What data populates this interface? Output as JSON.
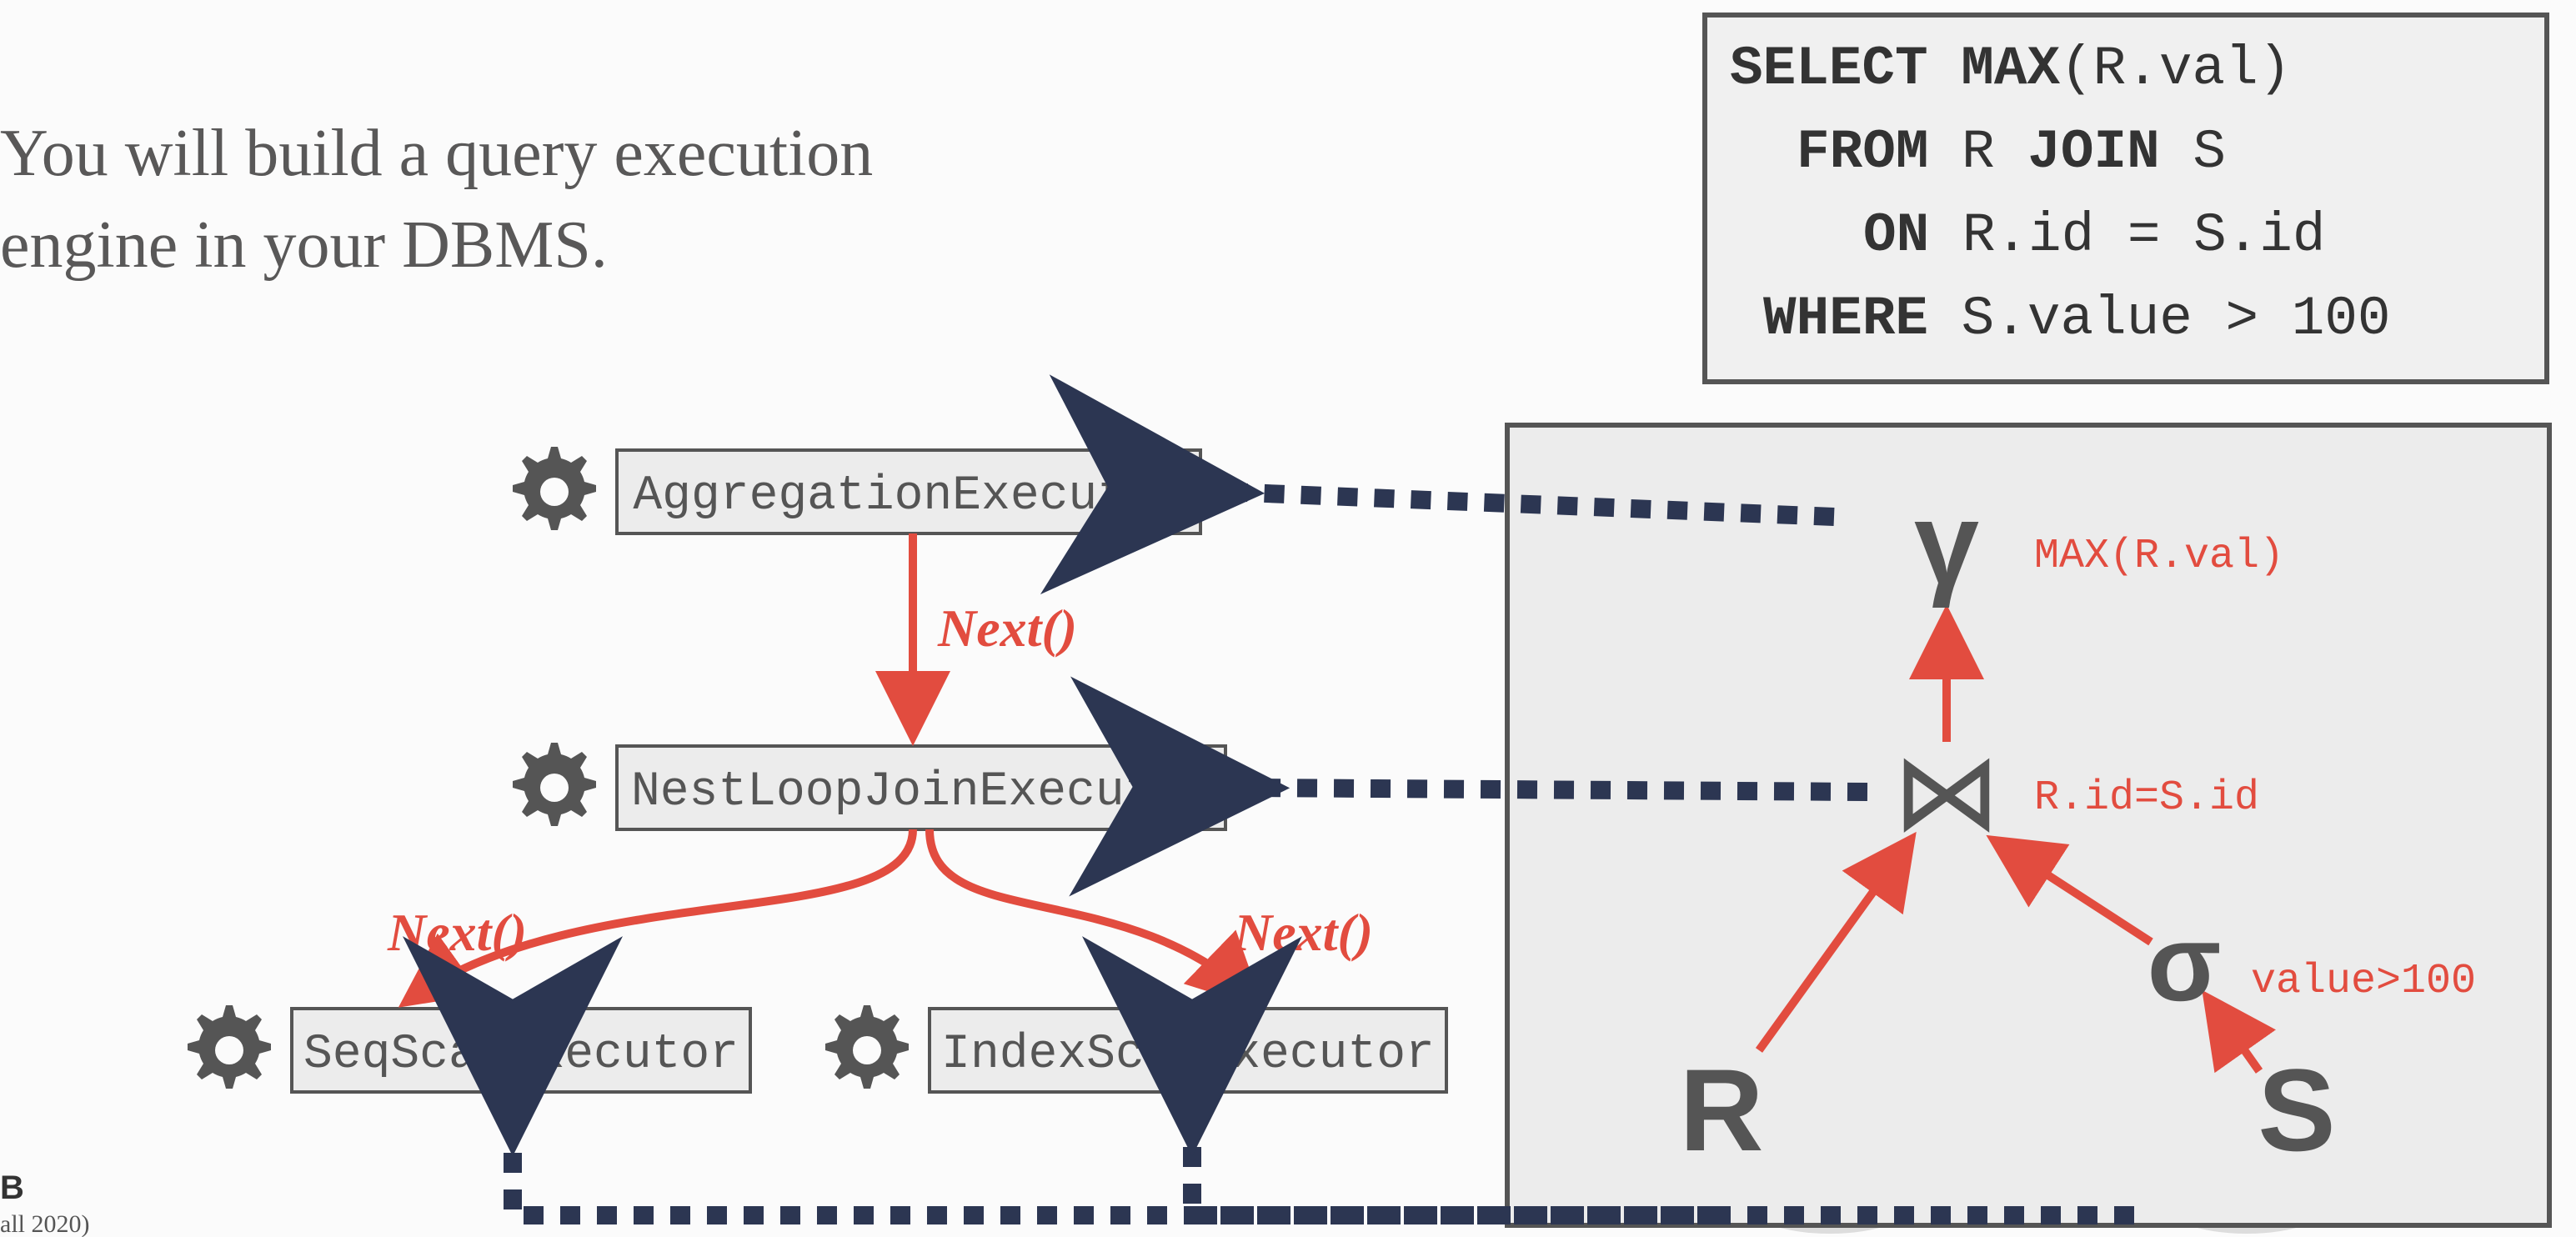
{
  "heading_line1": "You will build a query execution",
  "heading_line2": "engine in your DBMS.",
  "executors": {
    "agg": "AggregationExecutor",
    "join": "NestLoopJoinExecutor",
    "seq": "SeqScanExecutor",
    "idx": "IndexScanExecutor"
  },
  "next_label": "Next()",
  "sql": {
    "kw_select": "SELECT",
    "fn_max": "MAX",
    "arg_max": "(R.val)",
    "kw_from": "FROM",
    "r": "R",
    "kw_join": "JOIN",
    "s": "S",
    "kw_on": "ON",
    "on_expr": "R.id = S.id",
    "kw_where": "WHERE",
    "where_expr": "S.value > 100"
  },
  "tree": {
    "gamma": "γ",
    "gamma_lbl": "MAX(R.val)",
    "join": "⋈",
    "join_lbl": "R.id=S.id",
    "sigma": "σ",
    "sigma_lbl": "value>100",
    "R": "R",
    "S": "S"
  },
  "footer": {
    "b": "B",
    "sem": "all 2020)"
  }
}
